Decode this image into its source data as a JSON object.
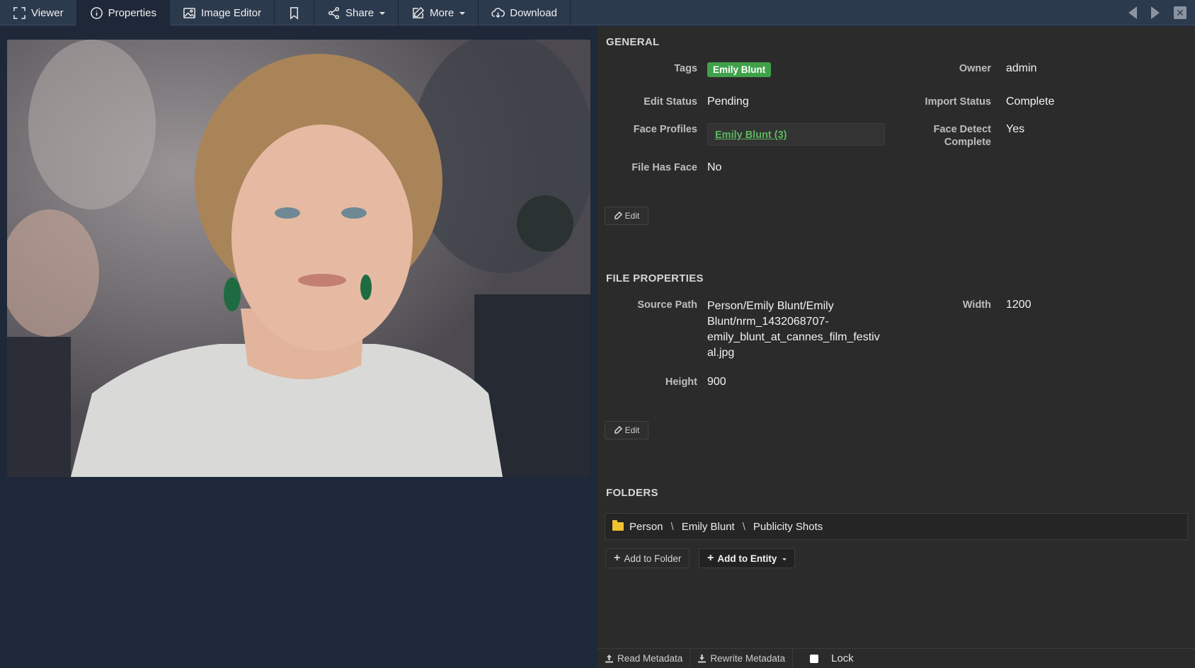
{
  "toolbar": {
    "viewer_label": "Viewer",
    "properties_label": "Properties",
    "image_editor_label": "Image Editor",
    "share_label": "Share",
    "more_label": "More",
    "download_label": "Download",
    "active_tab": "Properties"
  },
  "general": {
    "title": "GENERAL",
    "tags_label": "Tags",
    "tag_value": "Emily Blunt",
    "owner_label": "Owner",
    "owner_value": "admin",
    "edit_status_label": "Edit Status",
    "edit_status_value": "Pending",
    "import_status_label": "Import Status",
    "import_status_value": "Complete",
    "face_profiles_label": "Face Profiles",
    "face_profile_link": "Emily Blunt (3)",
    "face_detect_label_1": "Face Detect",
    "face_detect_label_2": "Complete",
    "face_detect_value": "Yes",
    "file_has_face_label": "File Has Face",
    "file_has_face_value": "No",
    "edit_label": "Edit"
  },
  "file_properties": {
    "title": "FILE PROPERTIES",
    "source_path_label": "Source Path",
    "source_path_lines": [
      "Person/Emily Blunt/Emily",
      "Blunt/nrm_1432068707-",
      "emily_blunt_at_cannes_film_festiv",
      "al.jpg"
    ],
    "width_label": "Width",
    "width_value": "1200",
    "height_label": "Height",
    "height_value": "900",
    "edit_label": "Edit"
  },
  "folders": {
    "title": "FOLDERS",
    "path": [
      "Person",
      "Emily Blunt",
      "Publicity Shots"
    ],
    "path_separator": "\\",
    "add_to_folder_label": "Add to Folder",
    "add_to_entity_label": "Add to Entity"
  },
  "footer": {
    "read_metadata_label": "Read Metadata",
    "rewrite_metadata_label": "Rewrite Metadata",
    "lock_label": "Lock",
    "lock_checked": false
  },
  "colors": {
    "toolbar_bg": "#2c3a4e",
    "viewer_bg": "#1e2838",
    "panel_bg": "#2b2b2b",
    "tag_green": "#3fa14a",
    "link_green": "#5cb860",
    "folder_yellow": "#f2c230"
  },
  "icons": [
    "expand-icon",
    "info-icon",
    "image-icon",
    "bookmark-icon",
    "share-icon",
    "edit-icon",
    "cloud-download-icon",
    "prev-arrow-icon",
    "next-arrow-icon",
    "close-icon",
    "folder-icon",
    "upload-icon",
    "download-icon"
  ]
}
